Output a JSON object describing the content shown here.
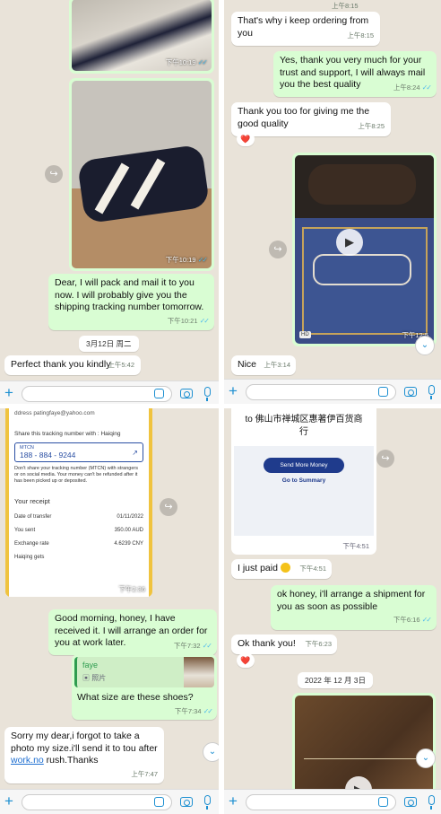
{
  "p1": {
    "photo1_time": "下午10:19",
    "photo2_time": "下午10:19",
    "msg_pack": "Dear, I will pack and mail it to you now. I will probably give you the shipping tracking number tomorrow.",
    "msg_pack_time": "下午10:21",
    "date_chip": "3月12日 周二",
    "msg_thanks": "Perfect thank you kindly",
    "msg_thanks_time": "上午5:42"
  },
  "p2": {
    "top_time": "上午8:15",
    "msg_ordering": "That's why i keep ordering from you",
    "msg_ordering_time": "上午8:15",
    "msg_yes": "Yes, thank you very much for your trust and support, I will always mail you the best quality",
    "msg_yes_time": "上午8:24",
    "msg_thankyou": "Thank  you too for giving me the good quality",
    "msg_thankyou_time": "上午8:25",
    "reaction": "❤️",
    "video_label": "HD",
    "video_time": "下午12:5",
    "msg_nice": "Nice",
    "msg_nice_time": "上午3:14"
  },
  "p3": {
    "receipt_header": "ddress patingfaye@yahoo.com",
    "share_line": "Share this tracking number with : Haiqing",
    "mtcn_label": "MTCN",
    "mtcn_value": "188 - 884 - 9244",
    "warning": "Don't share your tracking number (MTCN) with strangers or on social media. Your money can't be refunded after it has been picked up or deposited.",
    "receipt_title": "Your receipt",
    "rows": [
      {
        "label": "Date of transfer",
        "value": "01/11/2022"
      },
      {
        "label": "You sent",
        "value": "350.00 AUD"
      },
      {
        "label": "Exchange rate",
        "value": "4.6239 CNY"
      },
      {
        "label": "Haiqing gets",
        "value": ""
      }
    ],
    "receipt_time": "下午2:36",
    "msg_morning": "Good morning, honey, I have received it. I will arrange an order for you at work later.",
    "msg_morning_time": "下午7:32",
    "quote_name": "faye",
    "quote_type": "照片",
    "msg_size": "What size are these shoes?",
    "msg_size_time": "下午7:34",
    "msg_sorry_a": "Sorry my dear,i forgot to take a photo my size.i'll send it to tou after ",
    "msg_sorry_link": "work.no",
    "msg_sorry_b": " rush.Thanks",
    "msg_sorry_time": "上午7:47"
  },
  "p4": {
    "recipient": "to 佛山市禅城区惠著伊百货商行",
    "send_button": "Send More Money",
    "summary_link": "Go to Summary",
    "card_time": "下午4:51",
    "msg_paid": "I just paid",
    "msg_paid_time": "下午4:51",
    "msg_ok_honey": "ok honey, i'll arrange a shipment for you as soon as possible",
    "msg_ok_honey_time": "下午6:16",
    "msg_okthanks": "Ok thank you!",
    "msg_okthanks_time": "下午6:23",
    "reaction": "❤️",
    "date_chip": "2022 年 12 月 3日"
  },
  "colors": {
    "outgoing": "#d9fdd3",
    "incoming": "#ffffff",
    "wallpaper": "#e9e3d9",
    "accent": "#1c8fd1",
    "ticks": "#53bdeb"
  },
  "icons": [
    "plus-icon",
    "sticker-icon",
    "camera-icon",
    "mic-icon",
    "share-icon",
    "chevron-down-icon",
    "play-icon"
  ]
}
